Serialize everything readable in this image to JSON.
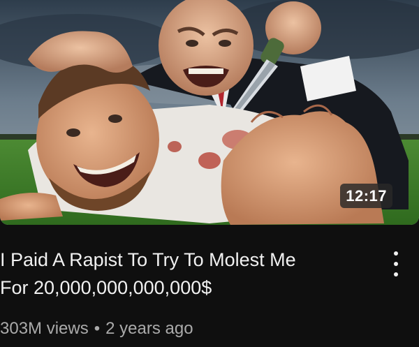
{
  "video": {
    "duration": "12:17",
    "title_line1": "I Paid A Rapist To Try To Molest Me",
    "title_line2": "For 20,000,000,000,000$",
    "views": "303M views",
    "separator": "•",
    "age": "2 years ago"
  },
  "icons": {
    "more_menu": "more-vertical-icon"
  },
  "colors": {
    "background": "#0f0f0f",
    "title_text": "#f1f1f1",
    "meta_text": "#aaaaaa",
    "duration_badge": "#282828"
  }
}
